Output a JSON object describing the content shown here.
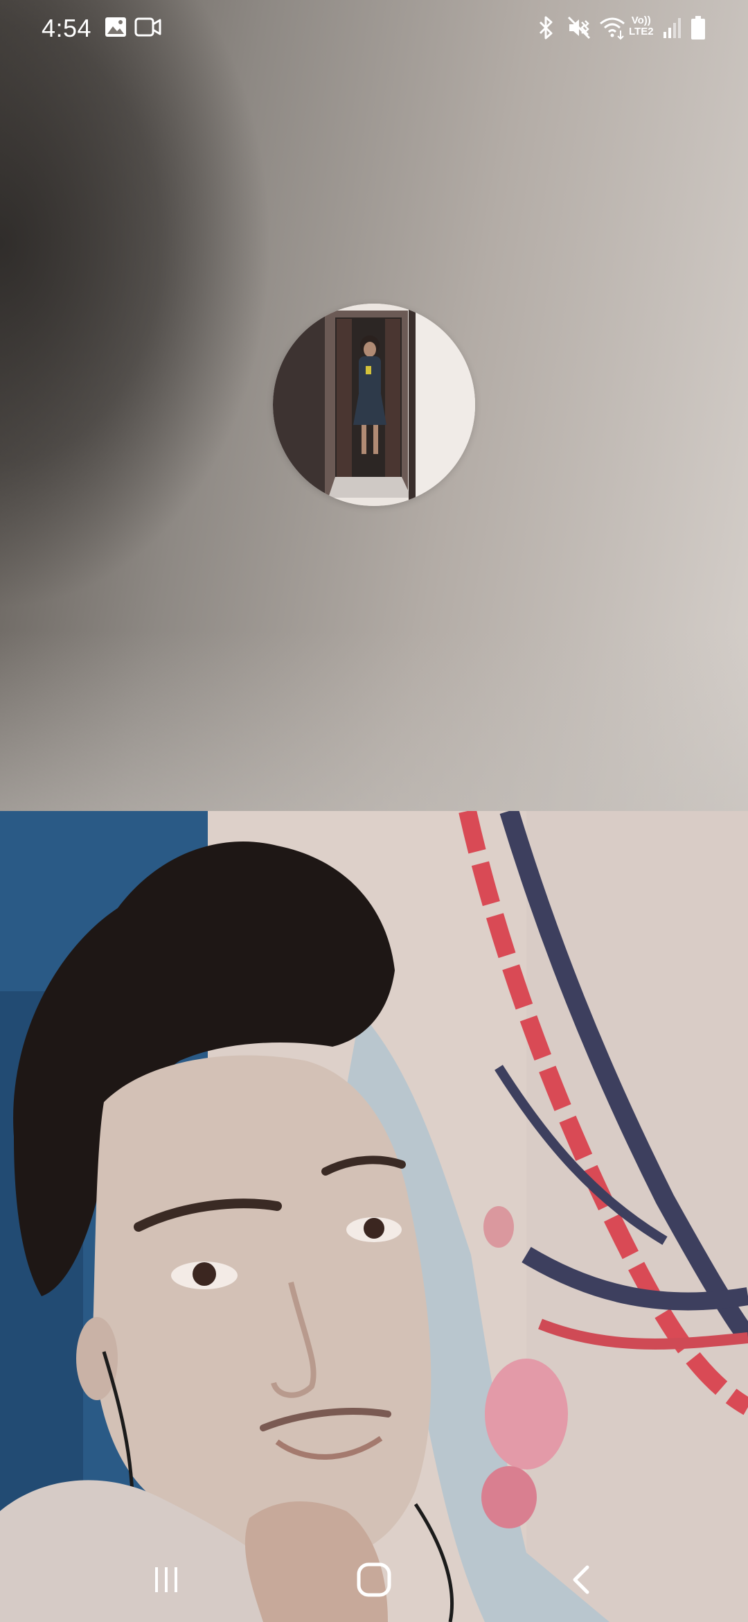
{
  "status_bar": {
    "time": "4:54",
    "icons_left": [
      "gallery-icon",
      "video-call-icon"
    ],
    "icons_right": [
      "bluetooth-icon",
      "mute-vibrate-icon",
      "wifi-calling-icon",
      "volte-lte2-icon",
      "signal-icon",
      "battery-icon"
    ],
    "volte_label": "Vo))",
    "lte_label": "LTE2"
  },
  "call": {
    "remote_avatar": "contact-photo",
    "local_preview": "front-camera-preview"
  },
  "nav_bar": {
    "buttons": [
      "recent-apps",
      "home",
      "back"
    ]
  },
  "colors": {
    "status_text": "#ffffff",
    "nav_icons": "#ffffff"
  }
}
